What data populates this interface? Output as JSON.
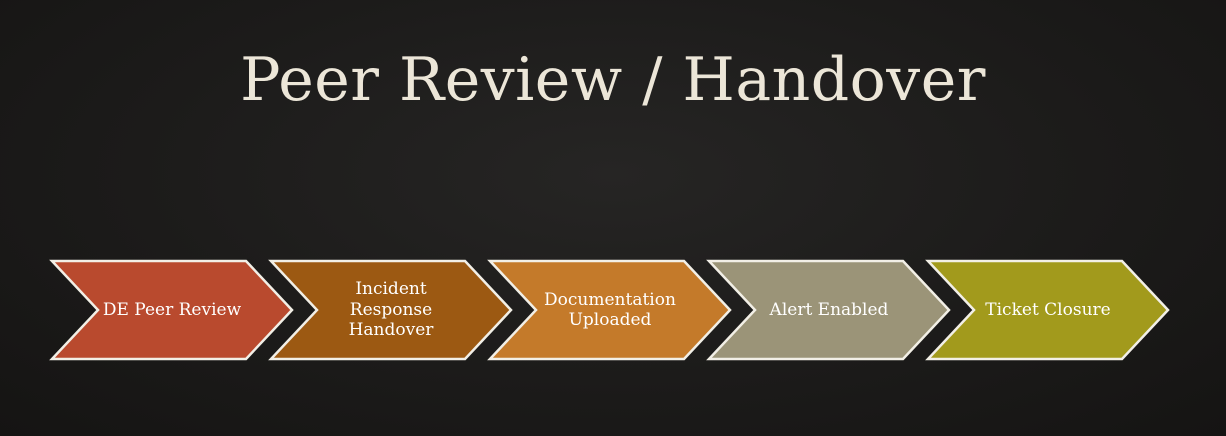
{
  "title": "Peer Review / Handover",
  "steps": [
    {
      "label": "DE Peer Review",
      "color": "#b94a2e"
    },
    {
      "label": "Incident\nResponse\nHandover",
      "color": "#9c5912"
    },
    {
      "label": "Documentation\nUploaded",
      "color": "#c47a2a"
    },
    {
      "label": "Alert Enabled",
      "color": "#9b9478"
    },
    {
      "label": "Ticket Closure",
      "color": "#a29a1c"
    }
  ],
  "outline_color": "#f2efe6",
  "icons": [
    "chevron-arrow-icon"
  ]
}
